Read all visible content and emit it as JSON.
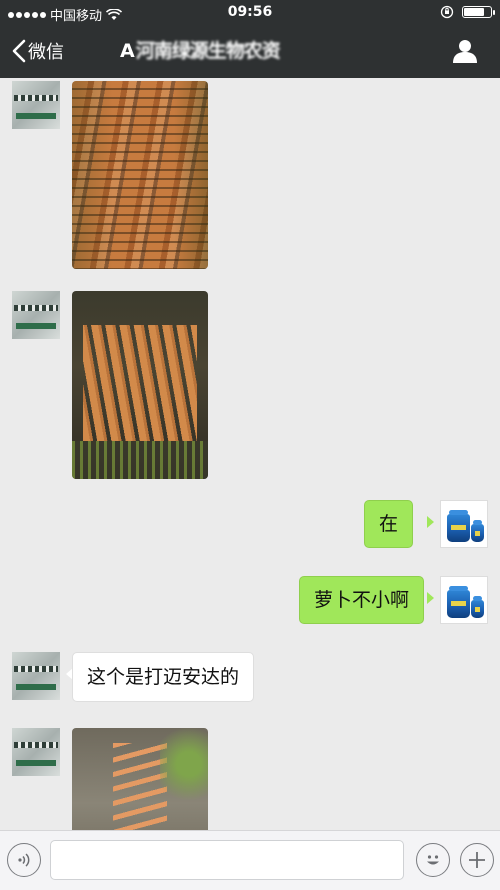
{
  "status_bar": {
    "carrier": "中国移动",
    "time": "09:56",
    "battery_level": 0.85
  },
  "nav_bar": {
    "back_label": "微信",
    "title": "A河南绿源生物农资",
    "title_prefix": "A",
    "title_obscured": "河南绿源生物农资"
  },
  "messages": [
    {
      "side": "left",
      "type": "image",
      "image": "carrots-pile-in-field"
    },
    {
      "side": "left",
      "type": "image",
      "image": "carrots-bunched-on-soil"
    },
    {
      "side": "right",
      "type": "text",
      "text": "在"
    },
    {
      "side": "right",
      "type": "text",
      "text": "萝卜不小啊"
    },
    {
      "side": "left",
      "type": "text",
      "text": "这个是打迈安达的"
    },
    {
      "side": "left",
      "type": "image",
      "image": "carrots-dug-from-mud"
    }
  ],
  "toolbar": {
    "voice_icon": "voice-icon",
    "emoji_icon": "emoji-icon",
    "plus_icon": "plus-icon"
  },
  "colors": {
    "nav_bg": "#2e3132",
    "chat_bg": "#ebebeb",
    "bubble_sent": "#a0e75a",
    "bubble_received": "#ffffff"
  }
}
